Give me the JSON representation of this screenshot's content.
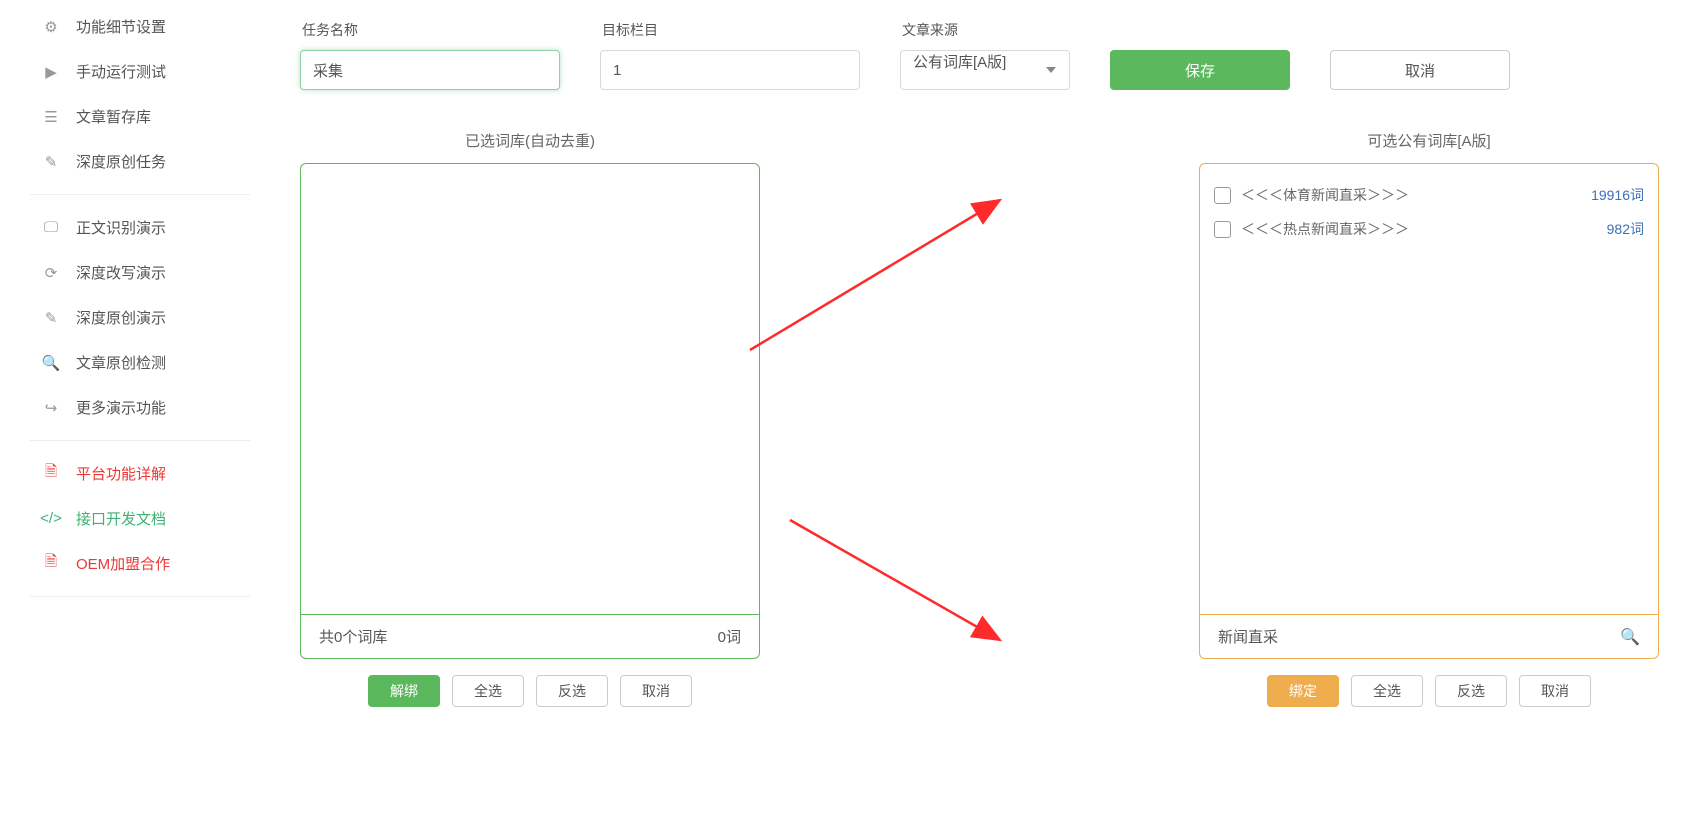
{
  "sidebar": {
    "group1": [
      {
        "label": "功能细节设置"
      },
      {
        "label": "手动运行测试"
      },
      {
        "label": "文章暂存库"
      },
      {
        "label": "深度原创任务"
      }
    ],
    "group2": [
      {
        "label": "正文识别演示"
      },
      {
        "label": "深度改写演示"
      },
      {
        "label": "深度原创演示"
      },
      {
        "label": "文章原创检测"
      },
      {
        "label": "更多演示功能"
      }
    ],
    "group3": [
      {
        "label": "平台功能详解"
      },
      {
        "label": "接口开发文档"
      },
      {
        "label": "OEM加盟合作"
      }
    ]
  },
  "form": {
    "taskLabel": "任务名称",
    "taskValue": "采集",
    "targetLabel": "目标栏目",
    "targetValue": "1",
    "sourceLabel": "文章来源",
    "sourceValue": "公有词库[A版]",
    "saveBtn": "保存",
    "cancelBtn": "取消"
  },
  "leftPanel": {
    "title": "已选词库(自动去重)",
    "footLeft": "共0个词库",
    "footRight": "0词",
    "btns": [
      "解绑",
      "全选",
      "反选",
      "取消"
    ]
  },
  "rightPanel": {
    "title": "可选公有词库[A版]",
    "items": [
      {
        "name": "＜＜＜体育新闻直采＞＞＞",
        "count": "19916词"
      },
      {
        "name": "＜＜＜热点新闻直采＞＞＞",
        "count": "982词"
      }
    ],
    "searchValue": "新闻直采",
    "btns": [
      "绑定",
      "全选",
      "反选",
      "取消"
    ]
  }
}
